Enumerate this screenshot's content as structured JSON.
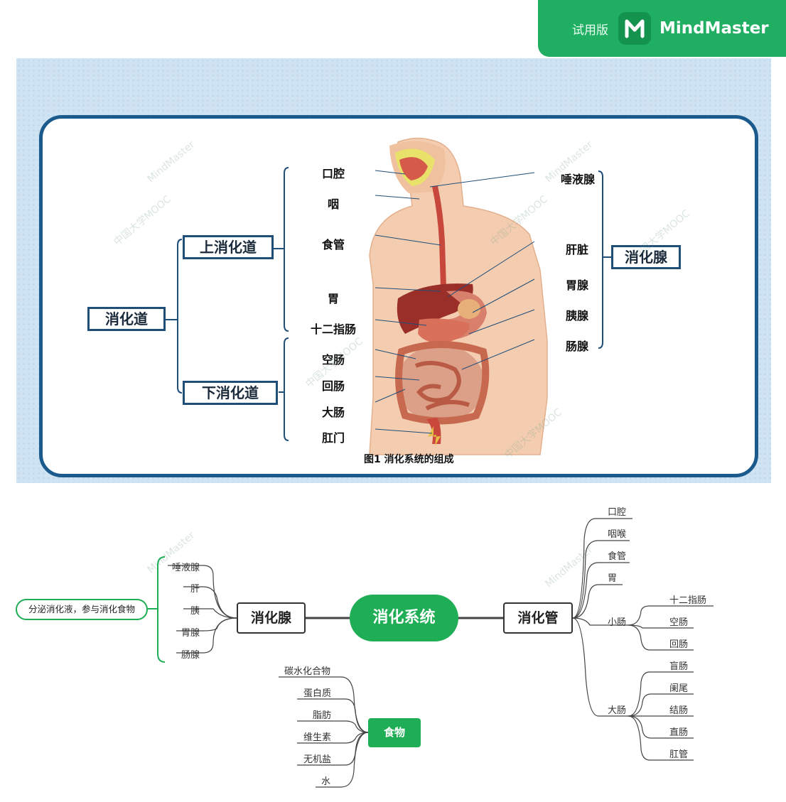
{
  "badge": {
    "trial": "试用版",
    "product": "MindMaster"
  },
  "figure": {
    "tract": "消化道",
    "upper": "上消化道",
    "lower": "下消化道",
    "glands": "消化腺",
    "left_organs": [
      "口腔",
      "咽",
      "食管",
      "胃",
      "十二指肠",
      "空肠",
      "回肠",
      "大肠",
      "肛门"
    ],
    "right_organs": [
      "唾液腺",
      "肝脏",
      "胃腺",
      "胰腺",
      "肠腺"
    ],
    "caption": "图1 消化系统的组成",
    "watermarks": [
      "中国大学MOOC",
      "MindMaster"
    ]
  },
  "mindmap": {
    "center": "消化系统",
    "glands": {
      "label": "消化腺",
      "items": [
        "唾液腺",
        "肝",
        "胰",
        "胃腺",
        "肠腺"
      ],
      "note": "分泌消化液，参与消化食物"
    },
    "tract": {
      "label": "消化管",
      "items": [
        "口腔",
        "咽喉",
        "食管",
        "胃"
      ],
      "small": {
        "label": "小肠",
        "items": [
          "十二指肠",
          "空肠",
          "回肠"
        ]
      },
      "large": {
        "label": "大肠",
        "items": [
          "盲肠",
          "阑尾",
          "结肠",
          "直肠",
          "肛管"
        ]
      }
    },
    "food": {
      "label": "食物",
      "items": [
        "碳水化合物",
        "蛋白质",
        "脂肪",
        "维生素",
        "无机盐",
        "水"
      ]
    }
  },
  "colors": {
    "brand": "#1fae55",
    "frame": "#1a5a8c",
    "box_border": "#1f4e79"
  }
}
